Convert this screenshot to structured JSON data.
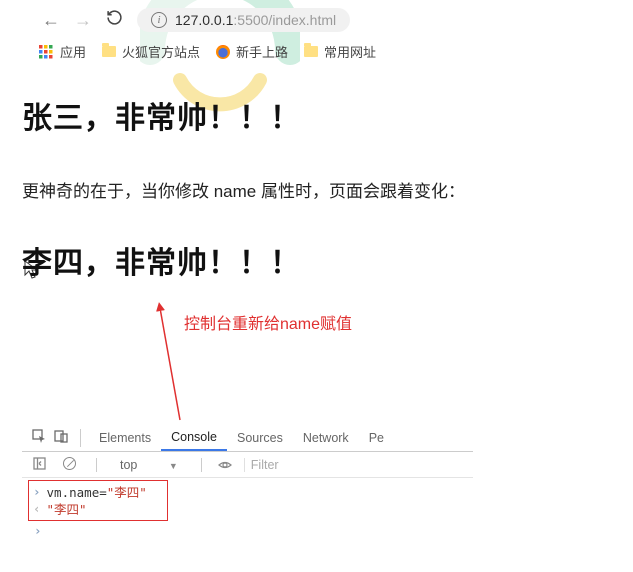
{
  "browser": {
    "url_host": "127.0.0.1",
    "url_port_path": ":5500/index.html"
  },
  "bookmarks": {
    "apps": "应用",
    "b1": "火狐官方站点",
    "b2": "新手上路",
    "b3": "常用网址"
  },
  "page": {
    "heading1": "张三，非常帅！！！",
    "desc": "更神奇的在于，当你修改 name 属性时，页面会跟着变化：",
    "heading2": "李四，非常帅！！！"
  },
  "annotation": {
    "label": "控制台重新给name赋值"
  },
  "devtools": {
    "tabs": {
      "elements": "Elements",
      "console": "Console",
      "sources": "Sources",
      "network": "Network",
      "perf": "Pe"
    },
    "context": "top",
    "filter_placeholder": "Filter",
    "console": {
      "line1_var": "vm",
      "line1_dot": ".",
      "line1_prop": "name",
      "line1_eq": "=",
      "line1_val": "\"李四\"",
      "line2_val": "\"李四\""
    }
  }
}
